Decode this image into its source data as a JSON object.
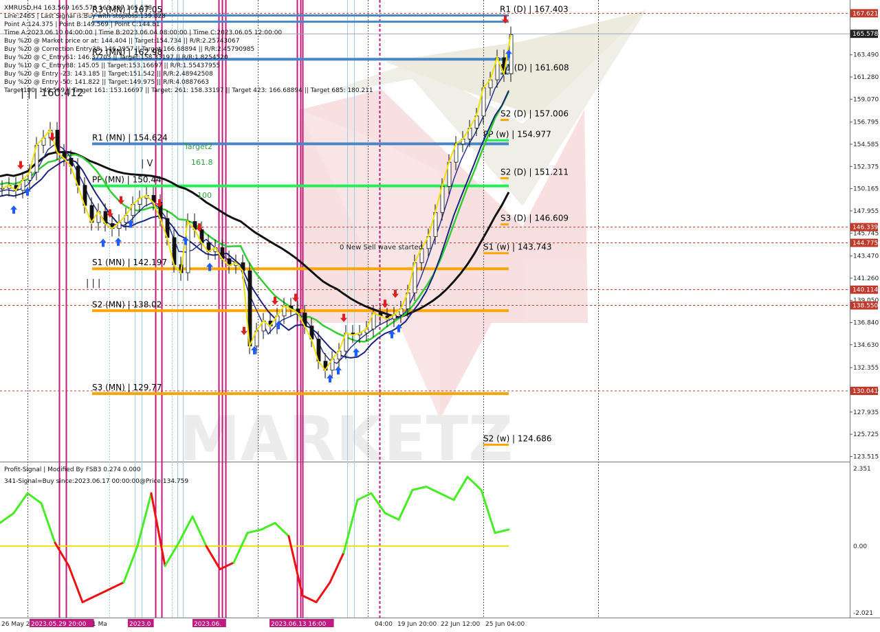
{
  "header": {
    "symbol_line": "XMRUSD,H4  163.569 165.578 163.397 165.578",
    "lines": [
      "Line:2465 | Last Signal is:Buy with stoploss:139.828",
      "Point A:124.375 | Point B:149.569 | Point C:144.81",
      "Time A:2023.06.10 04:00:00 | Time B:2023.06.04 08:00:00 | Time C:2023.06.05 12:00:00",
      "Buy %20 @ Market price or at: 144.404 || Target:154.734 || R/R:2.25743067",
      "Buy %20 @ Correction Entry38: 146.2957 || Target:166.68894 || R/R:2.45790985",
      "Buy %20 @ C_Entry61: 146.37703 || Target:158.33197 || R/R:1.8254520",
      "Buy %10 @ C_Entry88: 145.05 || Target:153.16697 || R/R:1.55437955",
      "Buy %20 @ Entry -23: 143.185 || Target:151.542 || R/R:2.48942508",
      "Buy %20 @ Entry -50: 141.822 || Target:149.975 || R/R:4.0887663",
      "Target100: 149.569 || Target 161: 153.16697 || Target: 261: 158.33197 || Target 423: 166.68894 || Target 685: 180.211"
    ]
  },
  "chart_labels": {
    "r3_mn": "R3 (MN) | 167.05",
    "r2_mn": "R2 (MN) | 162.98",
    "big_number": "| | | 160.412",
    "target2": "Target2",
    "t161": "161.8",
    "t100": "100",
    "roman_iv": "| V",
    "roman_iii": "| | |",
    "new_sell_wave": "0 New Sell wave started"
  },
  "levels": [
    {
      "label": "R1 (D) | 167.403",
      "value": 167.403,
      "color": "#4a86c5",
      "kind": "daily"
    },
    {
      "label": "R1 (MN) | 154.624",
      "value": 154.624,
      "color": "#4a86c5",
      "kind": "monthly"
    },
    {
      "label": "PP (MN) | 150.44",
      "value": 150.44,
      "color": "#22ee55",
      "kind": "monthly"
    },
    {
      "label": "S1 (MN) | 142.197",
      "value": 142.197,
      "color": "#ffa500",
      "kind": "monthly"
    },
    {
      "label": "S2 (MN) | 138.02",
      "value": 138.02,
      "color": "#ffa500",
      "kind": "monthly"
    },
    {
      "label": "S3 (MN) | 129.77",
      "value": 129.77,
      "color": "#ffa500",
      "kind": "monthly"
    },
    {
      "label": "R1 (D) | 161.608",
      "value": 161.608,
      "color": "#4a86c5",
      "kind": "daily"
    },
    {
      "label": "S2 (D) | 157.006",
      "value": 157.006,
      "color": "#ffa500",
      "kind": "daily"
    },
    {
      "label": "PP (w) | 154.977",
      "value": 154.977,
      "color": "#22ee55",
      "kind": "weekly"
    },
    {
      "label": "S2 (D) | 151.211",
      "value": 151.211,
      "color": "#ffa500",
      "kind": "daily"
    },
    {
      "label": "S3 (D) | 146.609",
      "value": 146.609,
      "color": "#ffa500",
      "kind": "daily"
    },
    {
      "label": "S1 (w) | 143.743",
      "value": 143.743,
      "color": "#ffa500",
      "kind": "weekly"
    },
    {
      "label": "S2 (w) | 124.686",
      "value": 124.686,
      "color": "#ffa500",
      "kind": "weekly"
    }
  ],
  "chart_data": {
    "type": "line",
    "title": "XMRUSD,H4",
    "ylim": [
      123.0,
      168.6
    ],
    "y_ticks": [
      "165.578",
      "163.490",
      "161.280",
      "159.070",
      "156.795",
      "154.585",
      "152.375",
      "150.165",
      "147.955",
      "145.745",
      "143.470",
      "141.260",
      "139.050",
      "136.840",
      "134.630",
      "132.355",
      "130.145",
      "127.935",
      "125.725",
      "123.515"
    ],
    "price_badges": [
      {
        "label": "167.621",
        "value": 167.621,
        "color": "#c0392b"
      },
      {
        "label": "165.578",
        "value": 165.578,
        "color": "#222222"
      },
      {
        "label": "146.339",
        "value": 146.339,
        "color": "#c0392b"
      },
      {
        "label": "144.775",
        "value": 144.775,
        "color": "#c0392b"
      },
      {
        "label": "140.114",
        "value": 140.114,
        "color": "#c0392b"
      },
      {
        "label": "138.550",
        "value": 138.55,
        "color": "#c0392b"
      },
      {
        "label": "130.041",
        "value": 130.041,
        "color": "#c0392b"
      }
    ],
    "x_labels": [
      "26 May 2",
      "2023.05.29 20:00",
      "1 Ma",
      "2023.0",
      "2023.06.",
      "2023.06.13 16:00",
      "04:00",
      "19 Jun 20:00",
      "22 Jun 12:00",
      "25 Jun 04:00"
    ],
    "price_series": {
      "name": "",
      "x": [
        0,
        10,
        20,
        30,
        40,
        50,
        60,
        70,
        80,
        90,
        100,
        110,
        120,
        130,
        140,
        150,
        160,
        170,
        180,
        190,
        200,
        210,
        220,
        230,
        240,
        250,
        260,
        270,
        280,
        290,
        300,
        310,
        320,
        330,
        340,
        350,
        360,
        370,
        380,
        390,
        400,
        410,
        420,
        430,
        440,
        450,
        460,
        470,
        480,
        490,
        500,
        510,
        520,
        530,
        540,
        550,
        560,
        570,
        580,
        590,
        600,
        610,
        620,
        630,
        640,
        650,
        660,
        670,
        680,
        690,
        700,
        710,
        720,
        730,
        740
      ],
      "y": [
        150.2,
        150.5,
        150.0,
        151.0,
        151.8,
        154.5,
        155.2,
        156.0,
        153.8,
        153.2,
        152.4,
        150.5,
        148.5,
        146.8,
        147.9,
        146.7,
        146.2,
        146.8,
        147.5,
        148.6,
        149.2,
        149.5,
        148.8,
        147.2,
        145.3,
        142.6,
        141.8,
        146.9,
        146.1,
        144.8,
        143.9,
        144.3,
        143.2,
        142.5,
        142.8,
        142.0,
        134.5,
        136.0,
        137.0,
        136.5,
        137.5,
        138.5,
        138.2,
        137.8,
        136.5,
        135.2,
        133.0,
        132.1,
        133.2,
        134.0,
        135.8,
        135.6,
        135.8,
        136.2,
        137.8,
        137.5,
        137.2,
        137.6,
        138.2,
        139.8,
        142.8,
        144.2,
        145.4,
        147.8,
        150.4,
        152.8,
        154.6,
        155.1,
        156.2,
        157.4,
        160.2,
        161.0,
        163.2,
        161.6,
        165.5
      ]
    },
    "oscillator": {
      "name": "Profit-Signal | Modified By FSB3 0.274 0.000",
      "subtitle": "341-Signal=Buy since:2023.06.17 00:00:00@Price:134.759",
      "ylim": [
        -2.021,
        2.351
      ],
      "y_ticks": [
        "2.351",
        "0.00",
        "-2.021"
      ],
      "x": [
        0,
        20,
        40,
        60,
        80,
        100,
        120,
        140,
        160,
        180,
        200,
        220,
        240,
        260,
        280,
        300,
        320,
        340,
        360,
        380,
        400,
        420,
        440,
        460,
        480,
        500,
        520,
        540,
        560,
        580,
        600,
        620,
        640,
        660,
        680,
        700,
        720,
        740
      ],
      "y": [
        0.7,
        1.0,
        1.6,
        1.3,
        0.1,
        -0.6,
        -1.7,
        -1.5,
        -1.3,
        -1.1,
        0.0,
        1.6,
        -0.6,
        0.1,
        0.9,
        0.0,
        -0.7,
        -0.5,
        0.4,
        0.5,
        0.7,
        0.3,
        -1.5,
        -1.7,
        -1.1,
        -0.2,
        1.4,
        1.6,
        1.0,
        0.8,
        1.7,
        1.8,
        1.6,
        1.4,
        2.1,
        1.7,
        0.4,
        0.5
      ]
    }
  }
}
